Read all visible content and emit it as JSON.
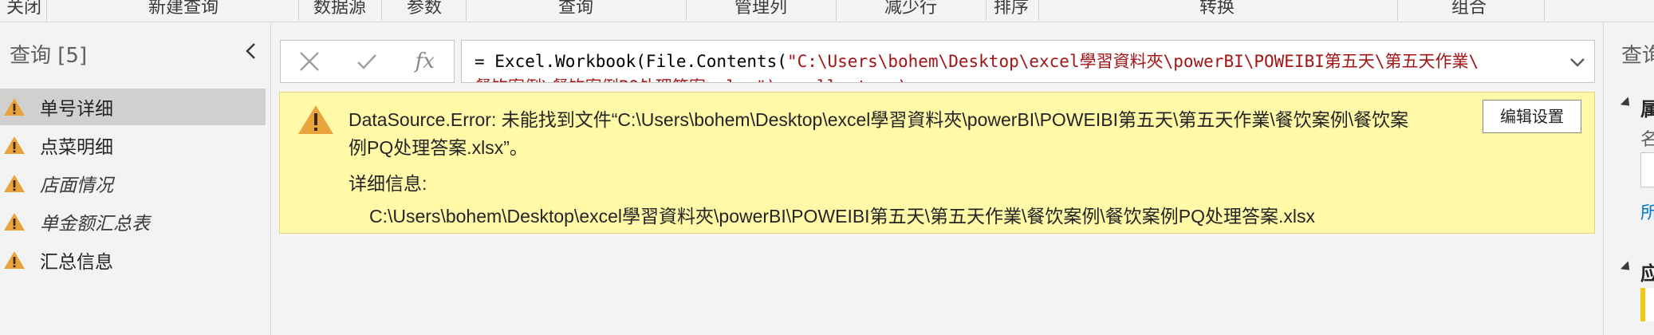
{
  "ribbon": {
    "groups": [
      "关闭",
      "新建查询",
      "数据源",
      "参数",
      "查询",
      "管理列",
      "减少行",
      "排序",
      "转换",
      "组合"
    ]
  },
  "queries_pane": {
    "title": "查询 [5]",
    "items": [
      {
        "label": "单号详细",
        "selected": true,
        "italic": false
      },
      {
        "label": "点菜明细",
        "selected": false,
        "italic": false
      },
      {
        "label": "店面情况",
        "selected": false,
        "italic": true
      },
      {
        "label": "单金额汇总表",
        "selected": false,
        "italic": true
      },
      {
        "label": "汇总信息",
        "selected": false,
        "italic": false
      }
    ]
  },
  "formula_bar": {
    "prefix": "= Excel.Workbook(File.Contents(",
    "string": "\"C:\\Users\\bohem\\Desktop\\excel學習資料夾\\powerBI\\POWEIBI第五天\\第五天作業\\",
    "line2_partial": "    餐饮案例\\餐饮案例PQ处理答案.xlsx\"), null, true)"
  },
  "error": {
    "line1": "DataSource.Error: 未能找到文件“C:\\Users\\bohem\\Desktop\\excel學習資料夾\\powerBI\\POWEIBI第五天\\第五天作業\\餐饮案例\\餐饮案",
    "line2": "例PQ处理答案.xlsx”。",
    "details_label": "详细信息:",
    "details_value": "C:\\Users\\bohem\\Desktop\\excel學習資料夾\\powerBI\\POWEIBI第五天\\第五天作業\\餐饮案例\\餐饮案例PQ处理答案.xlsx",
    "edit_button": "编辑设置"
  },
  "settings_pane": {
    "title": "查询",
    "properties_heading": "属",
    "name_label": "名",
    "link": "所",
    "steps_heading": "应"
  },
  "colors": {
    "warning": "#e8a33d",
    "error_bg": "#fff9a8",
    "string": "#a31515",
    "link": "#0078d4",
    "selected": "#d2d0ce"
  }
}
